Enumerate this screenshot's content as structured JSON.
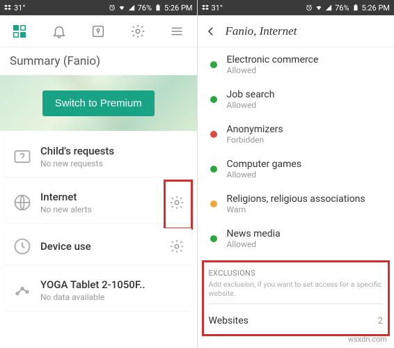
{
  "statusbar": {
    "left_text": "31°",
    "battery": "76%",
    "time": "5:26 PM"
  },
  "left": {
    "summary_title": "Summary (Fanio)",
    "premium_btn": "Switch to Premium",
    "cards": [
      {
        "title": "Child's requests",
        "sub": "No new requests"
      },
      {
        "title": "Internet",
        "sub": "No new alerts"
      },
      {
        "title": "Device use",
        "sub": ""
      },
      {
        "title": "YOGA Tablet 2-1050F..",
        "sub": "No data available"
      }
    ]
  },
  "right": {
    "header": "Fanio, Internet",
    "categories": [
      {
        "title": "Electronic commerce",
        "sub": "Allowed",
        "color": "#2aa83f"
      },
      {
        "title": "Job search",
        "sub": "Allowed",
        "color": "#2aa83f"
      },
      {
        "title": "Anonymizers",
        "sub": "Forbidden",
        "color": "#e0483e"
      },
      {
        "title": "Computer games",
        "sub": "Allowed",
        "color": "#2aa83f"
      },
      {
        "title": "Religions, religious associations",
        "sub": "Warn",
        "color": "#f2a63a"
      },
      {
        "title": "News media",
        "sub": "Allowed",
        "color": "#2aa83f"
      }
    ],
    "exclusions": {
      "label": "EXCLUSIONS",
      "hint": "Add exclusion, if you want to set access for a specific website.",
      "row_label": "Websites",
      "count": "2"
    }
  },
  "watermark": "wsxdn.com"
}
